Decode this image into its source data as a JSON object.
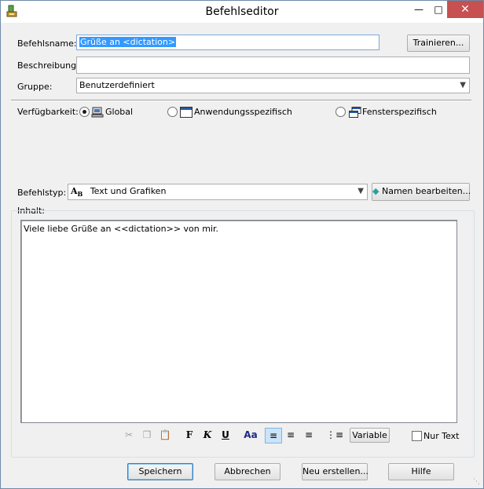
{
  "window": {
    "title": "Befehlseditor"
  },
  "form": {
    "name_label": "Befehlsname:",
    "name_value": "Grüße an <dictation>",
    "train_button": "Trainieren...",
    "description_label": "Beschreibung:",
    "description_value": "",
    "group_label": "Gruppe:",
    "group_value": "Benutzerdefiniert",
    "availability_label": "Verfügbarkeit:",
    "availability_options": [
      {
        "label": "Global",
        "selected": true,
        "icon": "computer-icon"
      },
      {
        "label": "Anwendungsspezifisch",
        "selected": false,
        "icon": "application-window-icon"
      },
      {
        "label": "Fensterspezifisch",
        "selected": false,
        "icon": "window-stack-icon"
      }
    ],
    "command_type_label": "Befehlstyp:",
    "command_type_value": "Text und Grafiken",
    "edit_names_button": "Namen bearbeiten...",
    "content_label": "Inhalt:",
    "content_text": "Viele liebe Grüße an <<dictation>> von mir."
  },
  "toolbar": {
    "bold": "F",
    "italic": "K",
    "underline": "U",
    "font": "Aa",
    "variable_button": "Variable",
    "plain_text_label": "Nur Text",
    "plain_text_checked": false
  },
  "footer": {
    "save": "Speichern",
    "cancel": "Abbrechen",
    "new": "Neu erstellen...",
    "help": "Hilfe"
  },
  "colors": {
    "selection": "#3399ff",
    "close_button": "#c75050",
    "default_button_border": "#3c7fb1"
  }
}
